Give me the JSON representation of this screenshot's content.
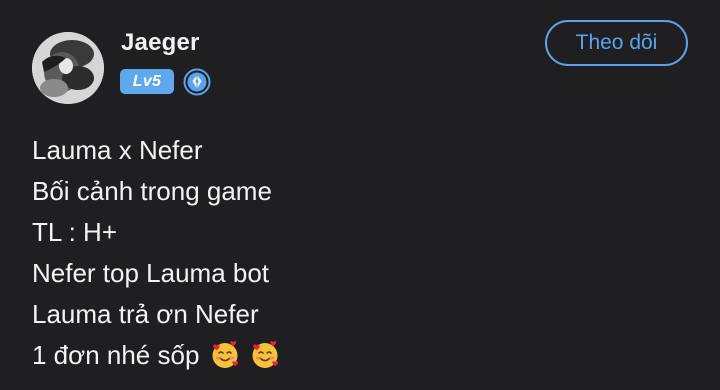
{
  "author": {
    "name": "Jaeger",
    "level": "Lv5",
    "avatar_icon": "avatar-image",
    "verify_icon": "creator-badge-icon"
  },
  "follow_button": {
    "label": "Theo dõi"
  },
  "post": {
    "lines": [
      "Lauma x Nefer",
      "Bối cảnh trong game",
      "TL : H+",
      "Nefer top Lauma bot",
      "Lauma trả ơn Nefer",
      "1 đơn nhé sốp"
    ],
    "trailing_emoji": [
      "smiling-face-with-hearts",
      "smiling-face-with-hearts"
    ]
  },
  "colors": {
    "background": "#1f1f21",
    "accent": "#5aa3ea",
    "badge": "#5fa8ee",
    "text": "#f3f3f3"
  }
}
